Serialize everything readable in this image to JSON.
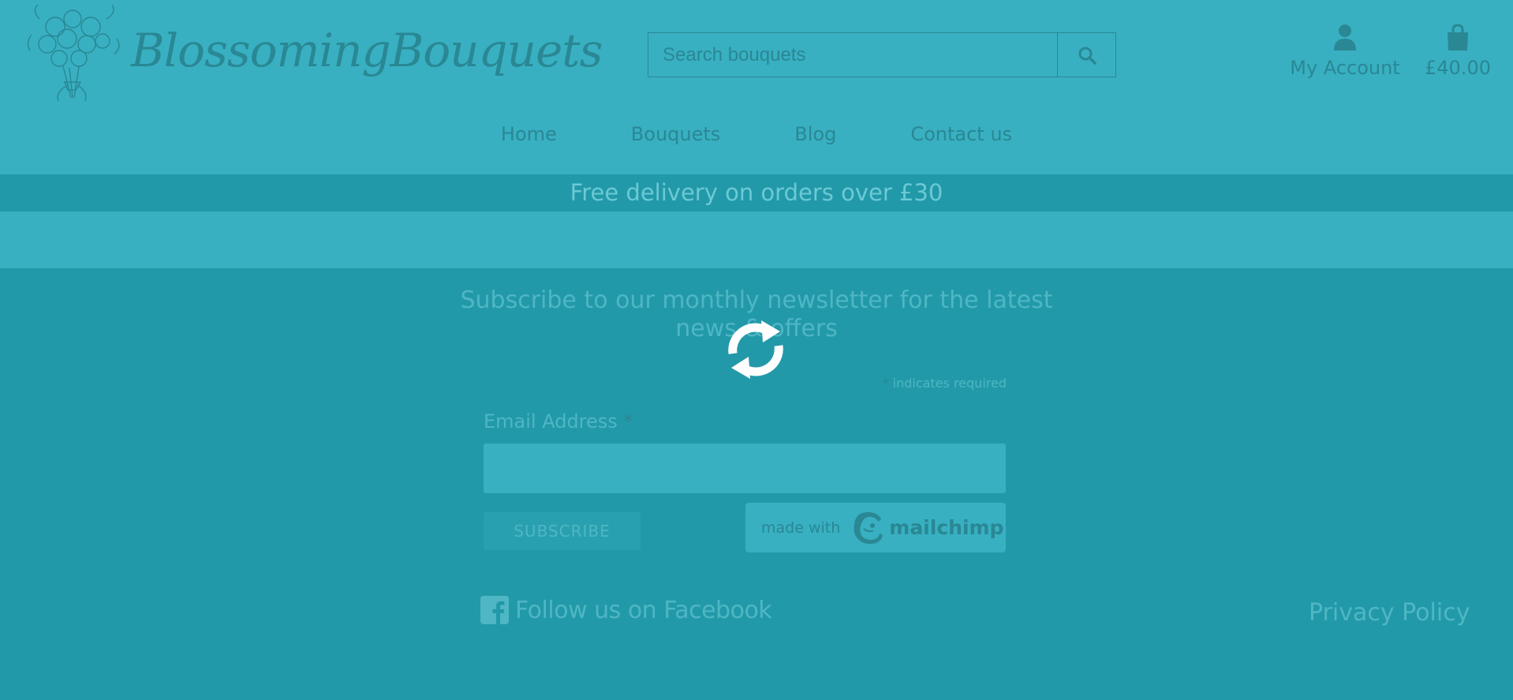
{
  "header": {
    "logo_text": "BlossomingBouquets",
    "search_placeholder": "Search bouquets",
    "account_label": "My Account",
    "basket_total": "£40.00"
  },
  "nav": {
    "items": [
      {
        "label": "Home"
      },
      {
        "label": "Bouquets"
      },
      {
        "label": "Blog"
      },
      {
        "label": "Contact us"
      }
    ]
  },
  "promo": {
    "text": "Free delivery on orders over £30"
  },
  "newsletter": {
    "title_line1": "Subscribe to our monthly newsletter for the latest",
    "title_line2": "news & offers",
    "required_star": "*",
    "required_note": "indicates required",
    "email_label": "Email Address",
    "email_star": "*",
    "subscribe_label": "SUBSCRIBE",
    "made_with": "made with",
    "mailchimp_brand": "mailchimp"
  },
  "footer": {
    "facebook_label": "Follow us on Facebook",
    "privacy_label": "Privacy Policy"
  },
  "colors": {
    "overlay_teal": "#2299a9",
    "light_teal": "#38b0c1",
    "dark_text": "#2a8794",
    "spinner": "#ffffff"
  },
  "icons": {
    "search": "search-icon",
    "account": "user-icon",
    "basket": "shopping-bag-icon",
    "facebook": "facebook-icon",
    "loading": "refresh-spinner-icon"
  }
}
